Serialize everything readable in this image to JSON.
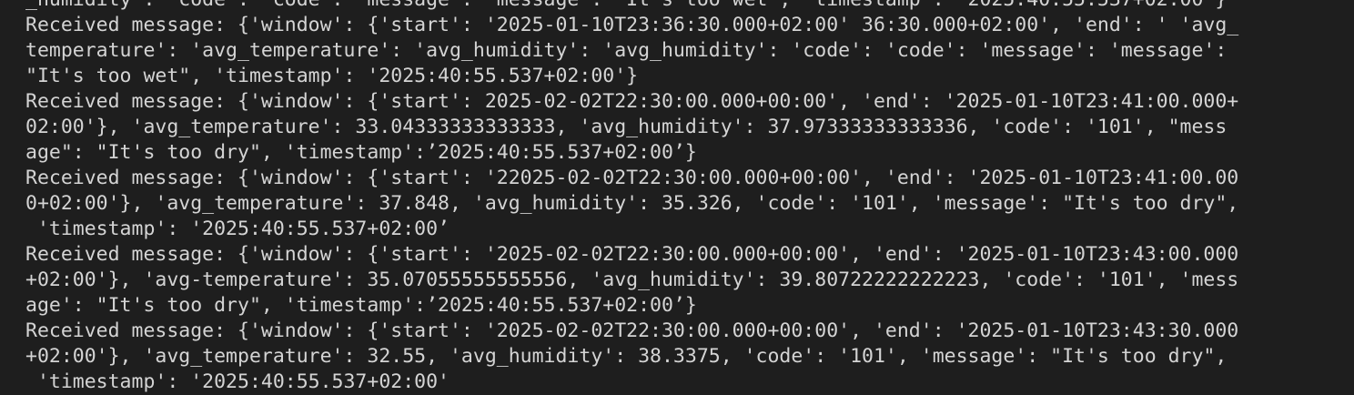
{
  "terminal": {
    "lines": [
      "_humidity': 'code': 'code': 'message': 'message': \"It's too wet\", 'timestamp': '2025:40:55.537+02:00'}",
      "Received message: {'window': {'start': '2025-01-10T23:36:30.000+02:00' 36:30.000+02:00', 'end': ' 'avg_",
      "temperature': 'avg_temperature': 'avg_humidity': 'avg_humidity': 'code': 'code': 'message': 'message':",
      "\"It's too wet\", 'timestamp': '2025:40:55.537+02:00'}",
      "Received message: {'window': {'start': 2025-02-02T22:30:00.000+00:00', 'end': '2025-01-10T23:41:00.000+",
      "02:00'}, 'avg_temperature': 33.04333333333333, 'avg_humidity': 37.97333333333336, 'code': '101', \"mess",
      "age\": \"It's too dry\", 'timestamp':’2025:40:55.537+02:00’}",
      "Received message: {'window': {'start': '22025-02-02T22:30:00.000+00:00', 'end': '2025-01-10T23:41:00.00",
      "0+02:00'}, 'avg_temperature': 37.848, 'avg_humidity': 35.326, 'code': '101', 'message': \"It's too dry\",",
      " 'timestamp': '2025:40:55.537+02:00’",
      "Received message: {'window': {'start': '2025-02-02T22:30:00.000+00:00', 'end': '2025-01-10T23:43:00.000",
      "+02:00'}, 'avg-temperature': 35.07055555555556, 'avg_humidity': 39.80722222222223, 'code': '101', 'mess",
      "age': \"It's too dry\", 'timestamp':’2025:40:55.537+02:00’}",
      "Received message: {'window': {'start': '2025-02-02T22:30:00.000+00:00', 'end': '2025-01-10T23:43:30.000",
      "+02:00'}, 'avg_temperature': 32.55, 'avg_humidity': 38.3375, 'code': '101', 'message': \"It's too dry\",",
      " 'timestamp': '2025:40:55.537+02:00'"
    ]
  }
}
